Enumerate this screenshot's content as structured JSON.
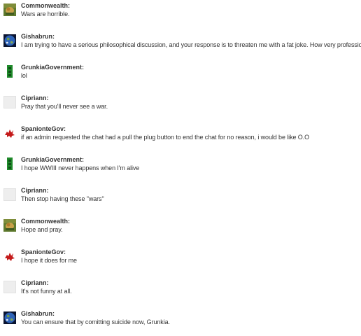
{
  "messages": [
    {
      "author": "Commonwealth:",
      "text": "Wars are horrible.",
      "avatar": "lion-flag-icon"
    },
    {
      "author": "Gishabrun:",
      "text": "I am trying to have a serious philosophical discussion, and your response is to threaten me with a fat joke. How very professional.",
      "avatar": "earth-globe-icon"
    },
    {
      "author": "GrunkiaGovernment:",
      "text": "lol",
      "avatar": "green-flag-icon"
    },
    {
      "author": "Cipriann:",
      "text": "Pray that you'll never see a war.",
      "avatar": "blank-avatar-icon"
    },
    {
      "author": "SpanionteGov:",
      "text": "if an admin requested the chat had a pull the plug button to end the chat for no reason, i would be like O.O",
      "avatar": "red-dragon-icon"
    },
    {
      "author": "GrunkiaGovernment:",
      "text": "I hope WWIII never happens when I'm alive",
      "avatar": "green-flag-icon"
    },
    {
      "author": "Cipriann:",
      "text": "Then stop having these \"wars\"",
      "avatar": "blank-avatar-icon"
    },
    {
      "author": "Commonwealth:",
      "text": "Hope and pray.",
      "avatar": "lion-flag-icon"
    },
    {
      "author": "SpanionteGov:",
      "text": "I hope it does for me",
      "avatar": "red-dragon-icon"
    },
    {
      "author": "Cipriann:",
      "text": "It's not funny at all.",
      "avatar": "blank-avatar-icon"
    },
    {
      "author": "Gishabrun:",
      "text": "You can ensure that by comitting suicide now, Grunkia.",
      "avatar": "earth-globe-icon"
    }
  ],
  "colors": {
    "text": "#333333",
    "background": "#ffffff"
  }
}
